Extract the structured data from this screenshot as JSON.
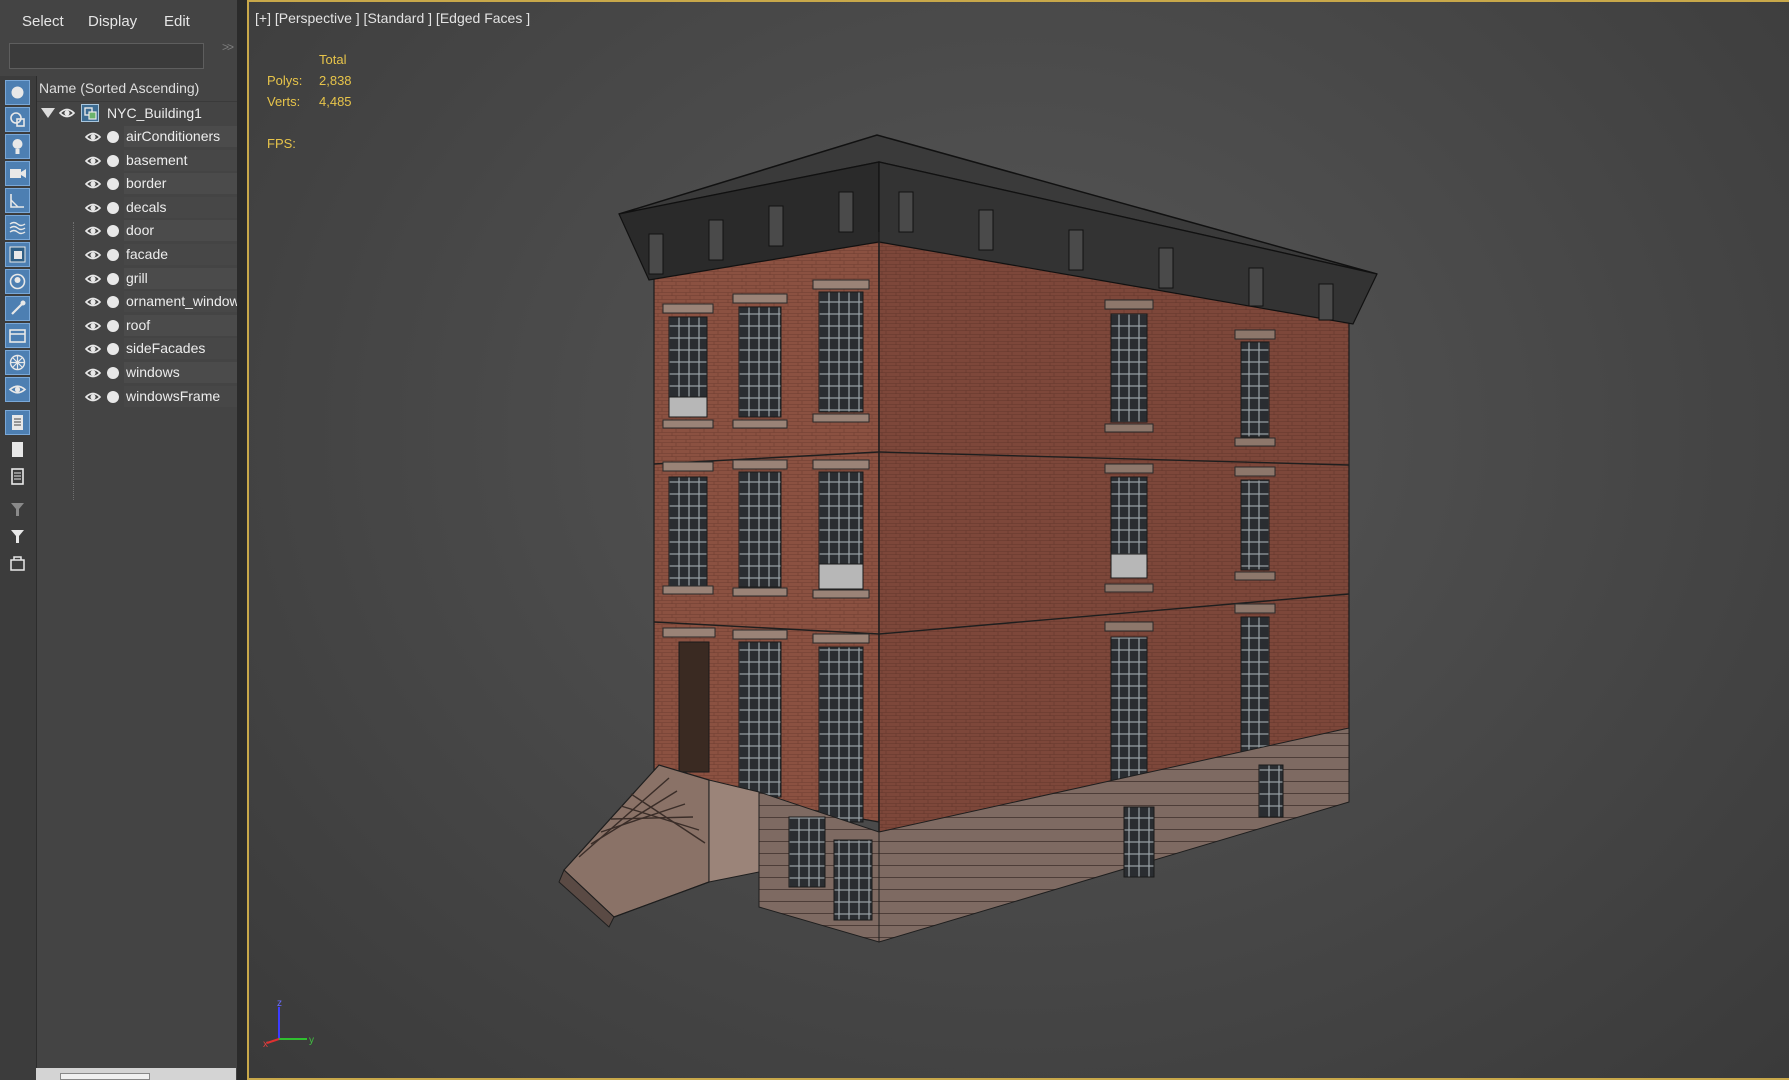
{
  "menu": {
    "items": [
      "Select",
      "Display",
      "Edit"
    ]
  },
  "explorer": {
    "column_header": "Name (Sorted Ascending)",
    "root": {
      "label": "NYC_Building1"
    },
    "children": [
      {
        "label": "airConditioners"
      },
      {
        "label": "basement"
      },
      {
        "label": "border"
      },
      {
        "label": "decals"
      },
      {
        "label": "door"
      },
      {
        "label": "facade"
      },
      {
        "label": "grill"
      },
      {
        "label": "ornament_window"
      },
      {
        "label": "roof"
      },
      {
        "label": "sideFacades"
      },
      {
        "label": "windows"
      },
      {
        "label": "windowsFrame"
      }
    ],
    "search_arrow": ">>"
  },
  "toolstrip": {
    "icons": [
      "geometry-icon",
      "shapes-icon",
      "lights-icon",
      "cameras-icon",
      "helpers-icon",
      "space-warps-icon",
      "groups-icon",
      "object-xrefs-icon",
      "bones-icon",
      "containers-icon",
      "frozen-icon",
      "hidden-icon",
      "display-all-icon",
      "display-none-icon",
      "invert-display-icon",
      "filter-icon",
      "filter-funnel-icon",
      "layer-icon"
    ]
  },
  "viewport": {
    "label": "[+] [Perspective ] [Standard ] [Edged Faces ]",
    "stats": {
      "header": "Total",
      "polys_label": "Polys:",
      "polys_value": "2,838",
      "verts_label": "Verts:",
      "verts_value": "4,485",
      "fps_label": "FPS:"
    },
    "gizmo_axes": [
      "z",
      "x",
      "y"
    ],
    "colors": {
      "frame": "#c8a84a",
      "stats_text": "#e7c44a",
      "brick": "#8a4e3d",
      "cornice": "#2e2e2e"
    }
  }
}
